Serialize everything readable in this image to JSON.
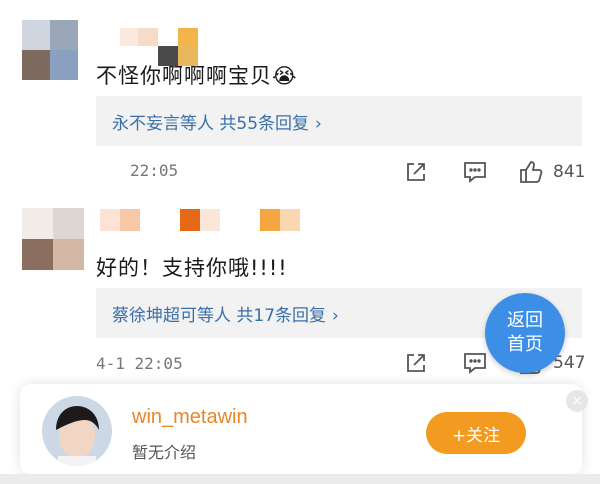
{
  "comments": [
    {
      "text": "不怪你啊啊啊宝贝",
      "emoji": "😭",
      "replies": "永不妄言等人  共55条回复",
      "time": "22:05",
      "like_count": "841"
    },
    {
      "text": "好的！支持你哦!!!!",
      "replies": "蔡徐坤超可等人  共17条回复",
      "time": "4-1 22:05",
      "like_count": "547"
    }
  ],
  "return_button": {
    "line1": "返回",
    "line2": "首页"
  },
  "profile_card": {
    "name": "win_metawin",
    "subtitle": "暂无介绍",
    "follow_label": "+关注",
    "close_glyph": "×"
  },
  "icons": {
    "share": "share-icon",
    "comment": "comment-icon",
    "like": "thumbs-up-icon",
    "chevron": "chevron-right-icon"
  },
  "colors": {
    "link": "#3a6fa8",
    "accent": "#f39a20",
    "name": "#e8862a",
    "return": "#3d8ee6"
  }
}
